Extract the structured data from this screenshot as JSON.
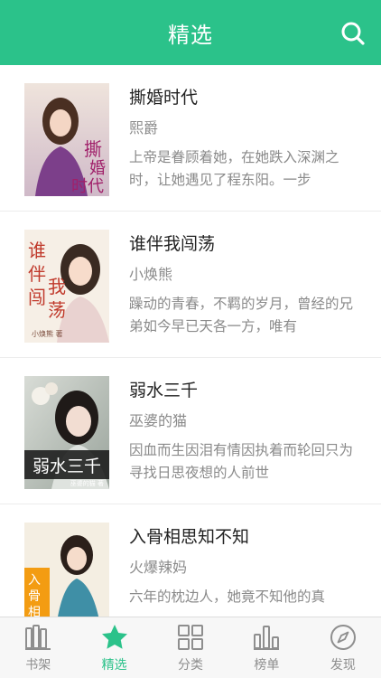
{
  "header": {
    "title": "精选"
  },
  "books": [
    {
      "title": "撕婚时代",
      "author": "熙爵",
      "desc": "上帝是眷顾着她，在她跌入深渊之时，让她遇见了程东阳。一步",
      "cover_text": "撕婚时代"
    },
    {
      "title": "谁伴我闯荡",
      "author": "小焕熊",
      "desc": "躁动的青春，不羁的岁月，曾经的兄弟如今早已天各一方，唯有",
      "cover_text": "谁伴我闯荡"
    },
    {
      "title": "弱水三千",
      "author": "巫婆的猫",
      "desc": "因血而生因泪有情因执着而轮回只为寻找日思夜想的人前世",
      "cover_text": "弱水三千"
    },
    {
      "title": "入骨相思知不知",
      "author": "火爆辣妈",
      "desc": "六年的枕边人，她竟不知他的真",
      "cover_text": "入骨相思知不知"
    }
  ],
  "tabbar": {
    "items": [
      {
        "label": "书架",
        "icon": "bookshelf-icon"
      },
      {
        "label": "精选",
        "icon": "star-icon"
      },
      {
        "label": "分类",
        "icon": "category-grid-icon"
      },
      {
        "label": "榜单",
        "icon": "ranking-bars-icon"
      },
      {
        "label": "发现",
        "icon": "compass-icon"
      }
    ],
    "active_index": 1
  },
  "colors": {
    "accent": "#2bc28a",
    "text_primary": "#222222",
    "text_secondary": "#8a8a8a",
    "tab_inactive": "#8e8e8e"
  }
}
